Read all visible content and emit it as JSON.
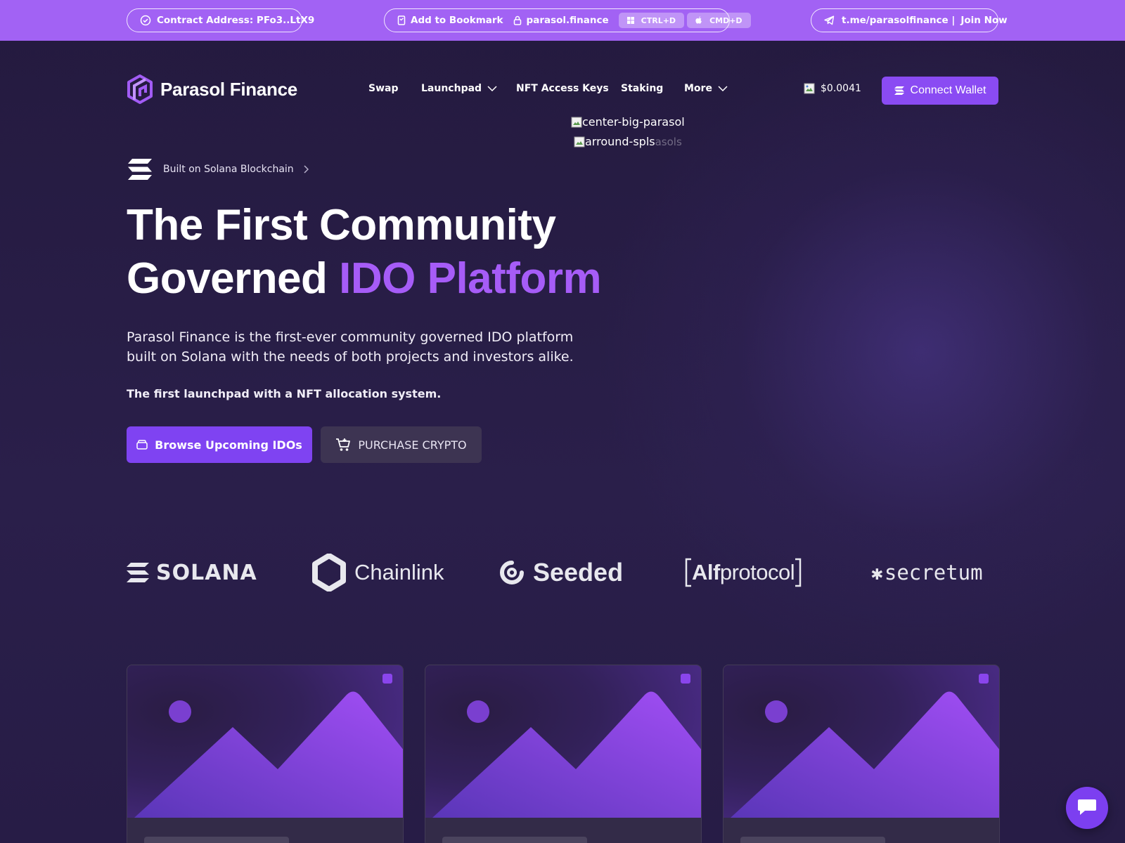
{
  "topbar": {
    "contract_label": "Contract Address: PFo3..LtX9",
    "bookmark_label": "Add to Bookmark",
    "domain": "parasol.finance",
    "shortcut_windows": "CTRL+D",
    "shortcut_mac": "CMD+D",
    "telegram_link": "t.me/parasolfinance |",
    "join_label": "Join Now"
  },
  "header": {
    "brand": "Parasol Finance",
    "nav": {
      "swap": "Swap",
      "launchpad": "Launchpad",
      "nft_access_keys": "NFT Access Keys",
      "staking": "Staking",
      "more": "More"
    },
    "token_price": "$0.0041",
    "connect_wallet": "Connect Wallet"
  },
  "hero_images": {
    "center_alt": "center-big-parasol",
    "around_alt": "arround-spls",
    "around_suffix": "asols"
  },
  "hero": {
    "badge": "Built on Solana Blockchain",
    "title_line1": "The First Community",
    "title_line2_plain": "Governed ",
    "title_line2_accent": "IDO Platform",
    "description": "Parasol Finance is the first-ever community governed IDO platform built on Solana with the needs of both projects and investors alike.",
    "subheading": "The first launchpad with a NFT allocation system.",
    "primary_button": "Browse Upcoming IDOs",
    "secondary_button": "PURCHASE CRYPTO"
  },
  "partners": {
    "solana": "SOLANA",
    "chainlink": "Chainlink",
    "seeded": "Seeded",
    "alf_bold": "Alf",
    "alf_light": "protocol",
    "secretum": "secretum"
  },
  "colors": {
    "topbar": "#a262f4",
    "accent": "#a65cf7",
    "primary_button": "#7f43f2",
    "background": "#241a3f"
  }
}
